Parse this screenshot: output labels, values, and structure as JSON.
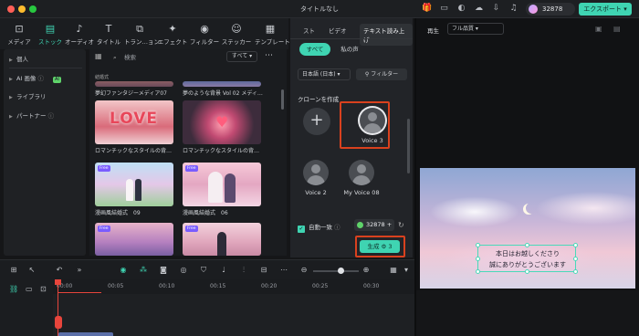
{
  "app": {
    "title": "タイトルなし",
    "credits": "32878",
    "export_label": "エクスポート"
  },
  "categories": [
    {
      "label": "メディア",
      "icon": "media-icon"
    },
    {
      "label": "ストック",
      "icon": "stock-icon",
      "active": true
    },
    {
      "label": "オーディオ",
      "icon": "music-note-icon"
    },
    {
      "label": "タイトル",
      "icon": "text-t-icon"
    },
    {
      "label": "トラン…ョン",
      "icon": "transition-icon"
    },
    {
      "label": "エフェクト",
      "icon": "sparkle-icon"
    },
    {
      "label": "フィルター",
      "icon": "filter-icon"
    },
    {
      "label": "ステッカー",
      "icon": "sticker-icon"
    },
    {
      "label": "テンプレート",
      "icon": "template-icon"
    }
  ],
  "sidebar": {
    "items": [
      {
        "label": "個人"
      },
      {
        "label": "AI 画像",
        "badge": "AI"
      },
      {
        "label": "ライブラリ"
      },
      {
        "label": "パートナー"
      }
    ]
  },
  "grid": {
    "search_placeholder": "検索",
    "all_label": "すべて",
    "section_label": "結婚式",
    "top_captions": [
      "夢幻ファンタジーメディア07",
      "夢のような背景 Vol 02 メディ…"
    ],
    "items": [
      {
        "caption": "ロマンチックなスタイルの背…",
        "free": false
      },
      {
        "caption": "ロマンチックなスタイルの背…",
        "free": false
      },
      {
        "caption": "漫画風結婚式　09",
        "free": true
      },
      {
        "caption": "漫画風結婚式　06",
        "free": true
      },
      {
        "caption": "",
        "free": true
      },
      {
        "caption": "",
        "free": true
      }
    ],
    "free_label": "Free"
  },
  "tts": {
    "tabs": [
      "スト",
      "ビデオ",
      "テキスト読み上げ"
    ],
    "active_tab": "テキスト読み上げ",
    "filter_pills": [
      "すべて",
      "私の声"
    ],
    "language": "日本語 (日本)",
    "filter_label": "フィルター",
    "clone_title": "クローンを作成",
    "voices": [
      {
        "name": "Voice 3",
        "selected": true
      },
      {
        "name": "Voice 2"
      },
      {
        "name": "My Voice 08"
      }
    ],
    "auto_match_label": "自動一致",
    "credit_value": "32878",
    "generate_label": "生成",
    "generate_cost": "3"
  },
  "preview": {
    "label": "再生",
    "quality": "フル品質",
    "caption_lines": [
      "本日はお越しくださり",
      "誠にありがとうございます"
    ]
  },
  "timeline": {
    "ticks": [
      "00:00",
      "00:05",
      "00:10",
      "00:15",
      "00:20",
      "00:25",
      "00:30"
    ],
    "zoom_level": 0.6
  },
  "colors": {
    "accent": "#3fd4b2",
    "highlight": "#d9411e",
    "playhead": "#e8453c"
  }
}
